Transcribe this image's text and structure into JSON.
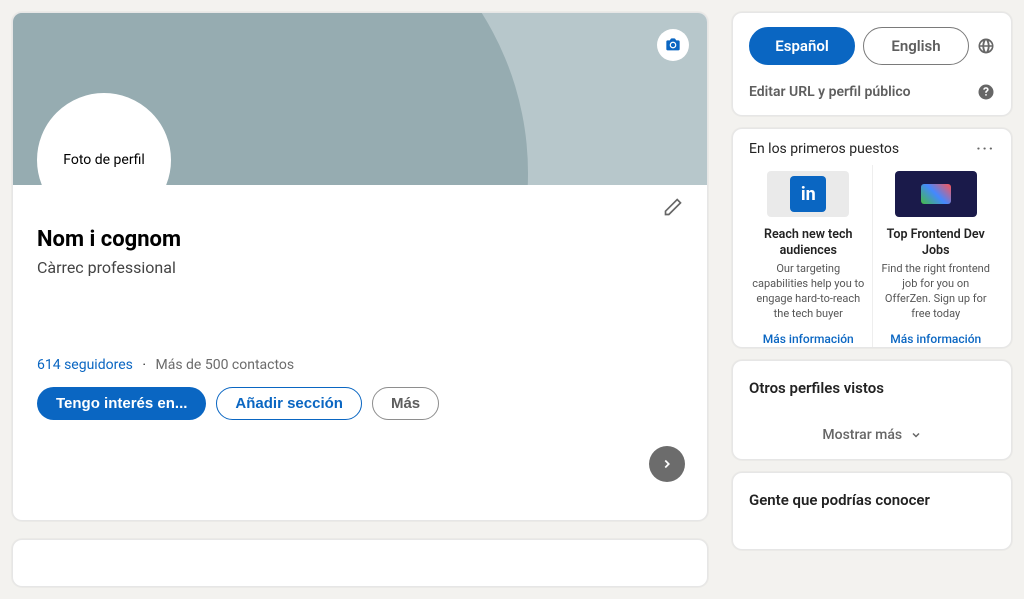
{
  "profile": {
    "avatar_label": "Foto de perfil",
    "name": "Nom i cognom",
    "role": "Càrrec professional",
    "followers": "614 seguidores",
    "contacts": "Más de 500 contactos"
  },
  "actions": {
    "interest": "Tengo interés en...",
    "add_section": "Añadir sección",
    "more": "Más"
  },
  "aside": {
    "lang_es": "Español",
    "lang_en": "English",
    "edit_url": "Editar URL y perfil público",
    "promo_header": "En los primeros puestos",
    "promo_dots": "···",
    "promo": [
      {
        "title": "Reach new tech audiences",
        "desc": "Our targeting capabilities help you to engage hard-to-reach the tech buyer",
        "link": "Más información"
      },
      {
        "title": "Top Frontend Dev Jobs",
        "desc": "Find the right frontend job for you on OfferZen. Sign up for free today",
        "link": "Más información"
      }
    ],
    "other_profiles": "Otros perfiles vistos",
    "show_more": "Mostrar más",
    "people_know": "Gente que podrías conocer"
  }
}
